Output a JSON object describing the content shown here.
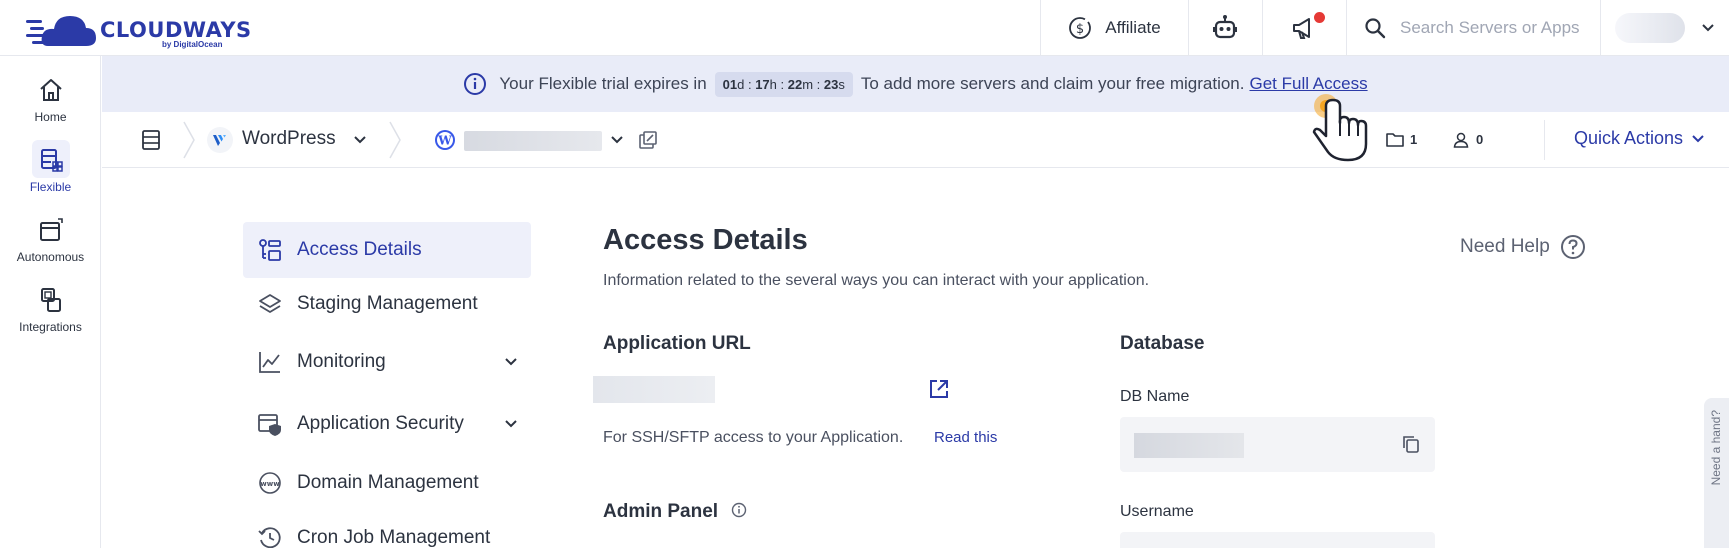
{
  "header": {
    "logo_text": "CLOUDWAYS",
    "logo_sub": "by DigitalOcean",
    "affiliate_label": "Affiliate",
    "search_placeholder": "Search Servers or Apps"
  },
  "rail": {
    "items": [
      {
        "label": "Home",
        "icon": "home-icon"
      },
      {
        "label": "Flexible",
        "icon": "flexible-icon"
      },
      {
        "label": "Autonomous",
        "icon": "autonomous-icon"
      },
      {
        "label": "Integrations",
        "icon": "integrations-icon"
      }
    ]
  },
  "banner": {
    "prefix": "Your Flexible trial expires in",
    "countdown": {
      "d": "01",
      "h": "17",
      "m": "22",
      "s": "23",
      "d_unit": "d",
      "h_unit": "h",
      "m_unit": "m",
      "s_unit": "s"
    },
    "suffix": "To add more servers and claim your free migration.",
    "link": "Get Full Access"
  },
  "subheader": {
    "app_type": "WordPress",
    "folders_count": "1",
    "members_count": "0",
    "quick_actions": "Quick Actions"
  },
  "nav": {
    "items": [
      {
        "label": "Access Details",
        "icon": "access-details-icon",
        "active": true
      },
      {
        "label": "Staging Management",
        "icon": "layers-icon"
      },
      {
        "label": "Monitoring",
        "icon": "chart-icon",
        "expandable": true
      },
      {
        "label": "Application Security",
        "icon": "shield-icon",
        "expandable": true
      },
      {
        "label": "Domain Management",
        "icon": "www-icon"
      },
      {
        "label": "Cron Job Management",
        "icon": "history-icon"
      }
    ]
  },
  "main": {
    "title": "Access Details",
    "description": "Information related to the several ways you can interact with your application.",
    "need_help": "Need Help",
    "app_url_heading": "Application URL",
    "ssh_text": "For SSH/SFTP access to your Application.",
    "read_this": "Read this",
    "admin_panel_heading": "Admin Panel",
    "database_heading": "Database",
    "db_name_label": "DB Name",
    "username_label": "Username",
    "side_tab": "Need a hand?"
  },
  "colors": {
    "brand": "#2b3aa7",
    "banner_bg": "#e9ecf8",
    "cursor_orange": "#f5a623"
  }
}
